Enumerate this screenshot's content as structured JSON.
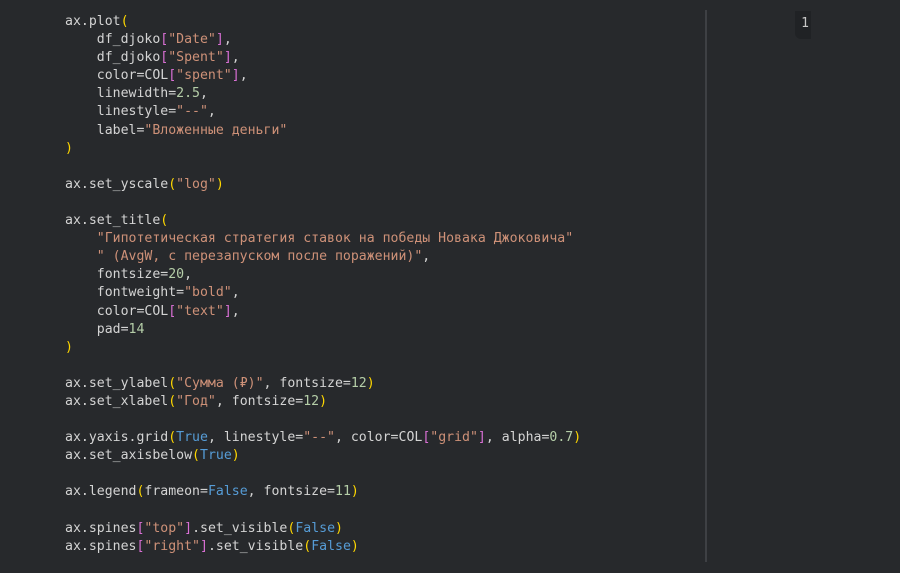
{
  "editor": {
    "line_badge": "1",
    "lines": [
      [
        [
          "ax.plot",
          "p"
        ],
        [
          "(",
          "y"
        ]
      ],
      [
        [
          "    df_djoko",
          "p"
        ],
        [
          "[",
          "m"
        ],
        [
          "\"Date\"",
          "s"
        ],
        [
          "]",
          "m"
        ],
        [
          ",",
          "p"
        ]
      ],
      [
        [
          "    df_djoko",
          "p"
        ],
        [
          "[",
          "m"
        ],
        [
          "\"Spent\"",
          "s"
        ],
        [
          "]",
          "m"
        ],
        [
          ",",
          "p"
        ]
      ],
      [
        [
          "    color=COL",
          "p"
        ],
        [
          "[",
          "m"
        ],
        [
          "\"spent\"",
          "s"
        ],
        [
          "]",
          "m"
        ],
        [
          ",",
          "p"
        ]
      ],
      [
        [
          "    linewidth=",
          "p"
        ],
        [
          "2.5",
          "n"
        ],
        [
          ",",
          "p"
        ]
      ],
      [
        [
          "    linestyle=",
          "p"
        ],
        [
          "\"--\"",
          "s"
        ],
        [
          ",",
          "p"
        ]
      ],
      [
        [
          "    label=",
          "p"
        ],
        [
          "\"Вложенные деньги\"",
          "s"
        ]
      ],
      [
        [
          ")",
          "y"
        ]
      ],
      [],
      [
        [
          "ax.set_yscale",
          "p"
        ],
        [
          "(",
          "y"
        ],
        [
          "\"log\"",
          "s"
        ],
        [
          ")",
          "y"
        ]
      ],
      [],
      [
        [
          "ax.set_title",
          "p"
        ],
        [
          "(",
          "y"
        ]
      ],
      [
        [
          "    ",
          "p"
        ],
        [
          "\"Гипотетическая стратегия ставок на победы Новака Джоковича\"",
          "s"
        ]
      ],
      [
        [
          "    ",
          "p"
        ],
        [
          "\" (AvgW, с перезапуском после поражений)\"",
          "s"
        ],
        [
          ",",
          "p"
        ]
      ],
      [
        [
          "    fontsize=",
          "p"
        ],
        [
          "20",
          "n"
        ],
        [
          ",",
          "p"
        ]
      ],
      [
        [
          "    fontweight=",
          "p"
        ],
        [
          "\"bold\"",
          "s"
        ],
        [
          ",",
          "p"
        ]
      ],
      [
        [
          "    color=COL",
          "p"
        ],
        [
          "[",
          "m"
        ],
        [
          "\"text\"",
          "s"
        ],
        [
          "]",
          "m"
        ],
        [
          ",",
          "p"
        ]
      ],
      [
        [
          "    pad=",
          "p"
        ],
        [
          "14",
          "n"
        ]
      ],
      [
        [
          ")",
          "y"
        ]
      ],
      [],
      [
        [
          "ax.set_ylabel",
          "p"
        ],
        [
          "(",
          "y"
        ],
        [
          "\"Сумма (₽)\"",
          "s"
        ],
        [
          ", fontsize=",
          "p"
        ],
        [
          "12",
          "n"
        ],
        [
          ")",
          "y"
        ]
      ],
      [
        [
          "ax.set_xlabel",
          "p"
        ],
        [
          "(",
          "y"
        ],
        [
          "\"Год\"",
          "s"
        ],
        [
          ", fontsize=",
          "p"
        ],
        [
          "12",
          "n"
        ],
        [
          ")",
          "y"
        ]
      ],
      [],
      [
        [
          "ax.yaxis.grid",
          "p"
        ],
        [
          "(",
          "y"
        ],
        [
          "True",
          "k"
        ],
        [
          ", linestyle=",
          "p"
        ],
        [
          "\"--\"",
          "s"
        ],
        [
          ", color=COL",
          "p"
        ],
        [
          "[",
          "m"
        ],
        [
          "\"grid\"",
          "s"
        ],
        [
          "]",
          "m"
        ],
        [
          ", alpha=",
          "p"
        ],
        [
          "0.7",
          "n"
        ],
        [
          ")",
          "y"
        ]
      ],
      [
        [
          "ax.set_axisbelow",
          "p"
        ],
        [
          "(",
          "y"
        ],
        [
          "True",
          "k"
        ],
        [
          ")",
          "y"
        ]
      ],
      [],
      [
        [
          "ax.legend",
          "p"
        ],
        [
          "(",
          "y"
        ],
        [
          "frameon=",
          "p"
        ],
        [
          "False",
          "k"
        ],
        [
          ", fontsize=",
          "p"
        ],
        [
          "11",
          "n"
        ],
        [
          ")",
          "y"
        ]
      ],
      [],
      [
        [
          "ax.spines",
          "p"
        ],
        [
          "[",
          "m"
        ],
        [
          "\"top\"",
          "s"
        ],
        [
          "]",
          "m"
        ],
        [
          ".set_visible",
          "p"
        ],
        [
          "(",
          "y"
        ],
        [
          "False",
          "k"
        ],
        [
          ")",
          "y"
        ]
      ],
      [
        [
          "ax.spines",
          "p"
        ],
        [
          "[",
          "m"
        ],
        [
          "\"right\"",
          "s"
        ],
        [
          "]",
          "m"
        ],
        [
          ".set_visible",
          "p"
        ],
        [
          "(",
          "y"
        ],
        [
          "False",
          "k"
        ],
        [
          ")",
          "y"
        ]
      ]
    ]
  }
}
